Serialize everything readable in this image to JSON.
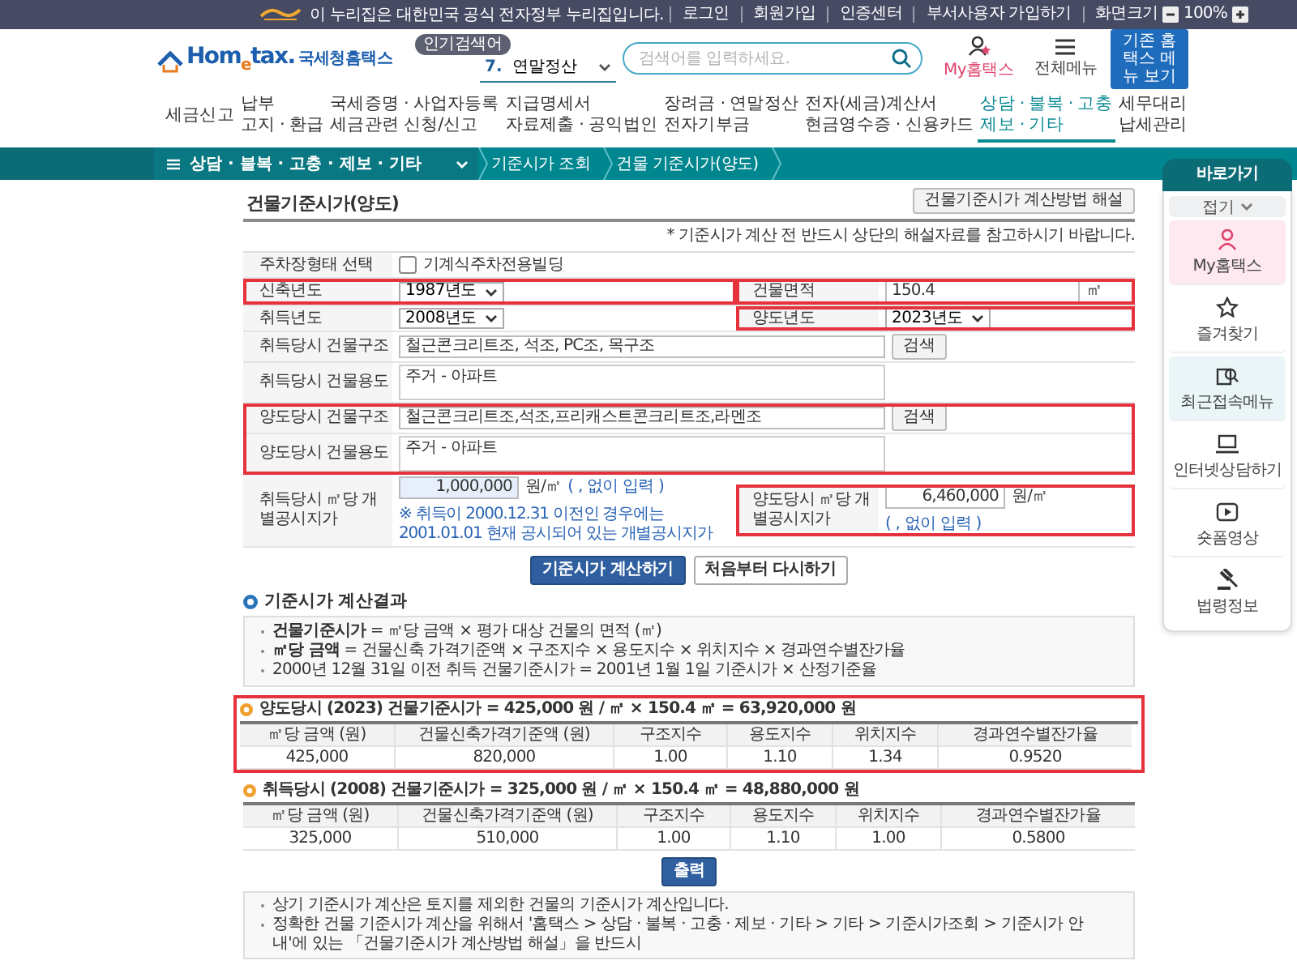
{
  "top_bar": {
    "notice": "이 누리집은 대한민국 공식 전자정부 누리집입니다.",
    "links": [
      "로그인",
      "회원가입",
      "인증센터",
      "부서사용자 가입하기"
    ],
    "zoom_label": "화면크기",
    "zoom_value": "100%"
  },
  "header": {
    "logo_text": "Hom$_{e}$tax.",
    "site_name": "국세청홈택스",
    "popular_badge": "인기검색어",
    "popular_rank": "7.",
    "popular_term": "연말정산",
    "search_placeholder": "검색어를 입력하세요.",
    "my_label": "My홈택스",
    "menu_label": "전체메뉴",
    "legacy_button": "기존 홈택스 메뉴 보기"
  },
  "main_nav": [
    {
      "lines": [
        "세금신고"
      ],
      "selected": false
    },
    {
      "lines": [
        "납부",
        "고지 · 환급"
      ],
      "selected": false
    },
    {
      "lines": [
        "국세증명 · 사업자등록",
        "세금관련 신청/신고"
      ],
      "selected": false
    },
    {
      "lines": [
        "지급명세서",
        "자료제출 · 공익법인"
      ],
      "selected": false
    },
    {
      "lines": [
        "장려금 · 연말정산",
        "전자기부금"
      ],
      "selected": false
    },
    {
      "lines": [
        "전자(세금)계산서",
        "현금영수증 · 신용카드"
      ],
      "selected": false
    },
    {
      "lines": [
        "상담 · 불복 · 고충",
        "제보 · 기타"
      ],
      "selected": true
    },
    {
      "lines": [
        "세무대리",
        "납세관리"
      ],
      "selected": false
    }
  ],
  "breadcrumb": {
    "menu": "상담 · 불복 · 고충 · 제보 · 기타",
    "items": [
      "기준시가 조회",
      "건물 기준시가(양도)"
    ]
  },
  "quick_menu": {
    "title": "바로가기",
    "collapse": "접기",
    "items": [
      {
        "kind": "person",
        "label": "My홈택스",
        "color": "#fde9ef"
      },
      {
        "kind": "star",
        "label": "즐겨찾기",
        "color": "#ffffff"
      },
      {
        "kind": "recent",
        "label": "최근접속메뉴",
        "color": "#e9f5f6"
      },
      {
        "kind": "laptop",
        "label": "인터넷상담하기",
        "color": "#ffffff"
      },
      {
        "kind": "play",
        "label": "숏폼영상",
        "color": "#ffffff"
      },
      {
        "kind": "gavel",
        "label": "법령정보",
        "color": "#ffffff"
      }
    ]
  },
  "page": {
    "title": "건물기준시가(양도)",
    "help_button": "건물기준시가 계산방법 해설",
    "notice": "* 기준시가 계산 전 반드시 상단의 해설자료를 참고하시기 바랍니다."
  },
  "form": {
    "parking": {
      "label": "주차장형태 선택",
      "option": "기계식주차전용빌딩",
      "checked": false
    },
    "build_year": {
      "label": "신축년도",
      "value": "1987년도",
      "highlighted": true
    },
    "area": {
      "label": "건물면적",
      "value": "150.4",
      "unit": "㎡",
      "highlighted": true
    },
    "acq_year": {
      "label": "취득년도",
      "value": "2008년도",
      "highlighted": false
    },
    "sale_year": {
      "label": "양도년도",
      "value": "2023년도",
      "highlighted": true
    },
    "acq_structure": {
      "label": "취득당시 건물구조",
      "value": "철근콘크리트조, 석조, PC조, 목구조",
      "button": "검색"
    },
    "acq_use": {
      "label": "취득당시 건물용도",
      "value": "주거 - 아파트"
    },
    "sale_group": {
      "highlighted": true,
      "structure": {
        "label": "양도당시 건물구조",
        "value": "철근콘크리트조,석조,프리캐스트콘크리트조,라멘조",
        "button": "검색"
      },
      "use": {
        "label": "양도당시 건물용도",
        "value": "주거 - 아파트"
      }
    },
    "acq_land_price": {
      "label": "취득당시 ㎡당 개별공시지가",
      "value": "1,000,000",
      "unit": "원/㎡",
      "hint": "( , 없이 입력 )",
      "note": "※ 취득이 2000.12.31 이전인 경우에는 2001.01.01 현재 공시되어 있는 개별공시지가"
    },
    "sale_land_price": {
      "label": "양도당시 ㎡당 개별공시지가",
      "value": "6,460,000",
      "unit": "원/㎡",
      "hint": "( , 없이 입력 )",
      "highlighted": true
    }
  },
  "buttons": [
    {
      "kind": "primary",
      "label": "기준시가 계산하기"
    },
    {
      "kind": "secondary",
      "label": "처음부터 다시하기"
    }
  ],
  "results": {
    "heading": "기준시가 계산결과",
    "formulas": [
      "**건물기준시가** = ㎡당 금액 × 평가 대상 건물의 면적 (㎡)",
      "**㎡당 금액** = 건물신축 가격기준액 × 구조지수 × 용도지수 × 위치지수 × 경과연수별잔가율",
      "2000년 12월 31일 이전 취득 건물기준시가 = 2001년 1월 1일 기준시가 × 산정기준율"
    ],
    "tables": [
      {
        "title": "양도당시 (2023) 건물기준시가 = 425,000 원 / ㎡ × 150.4 ㎡ = 63,920,000 원",
        "highlighted": true,
        "columns": [
          "㎡당 금액 (원)",
          "건물신축가격기준액 (원)",
          "구조지수",
          "용도지수",
          "위치지수",
          "경과연수별잔가율"
        ],
        "row": [
          "425,000",
          "820,000",
          "1.00",
          "1.10",
          "1.34",
          "0.9520"
        ]
      },
      {
        "title": "취득당시 (2008) 건물기준시가 = 325,000 원 / ㎡ × 150.4 ㎡ = 48,880,000 원",
        "highlighted": false,
        "columns": [
          "㎡당 금액 (원)",
          "건물신축가격기준액 (원)",
          "구조지수",
          "용도지수",
          "위치지수",
          "경과연수별잔가율"
        ],
        "row": [
          "325,000",
          "510,000",
          "1.00",
          "1.10",
          "1.00",
          "0.5800"
        ]
      }
    ],
    "print_button": "출력",
    "notes": [
      "상기 기준시가 계산은 토지를 제외한 건물의 기준시가 계산입니다.",
      "정확한 건물 기준시가 계산을 위해서 '홈택스 > 상담 · 불복 · 고충 · 제보 · 기타 > 기타 > 기준시가조회 > 기준시가 안내'에 있는 「건물기준시가 계산방법 해설」을 반드시"
    ]
  }
}
